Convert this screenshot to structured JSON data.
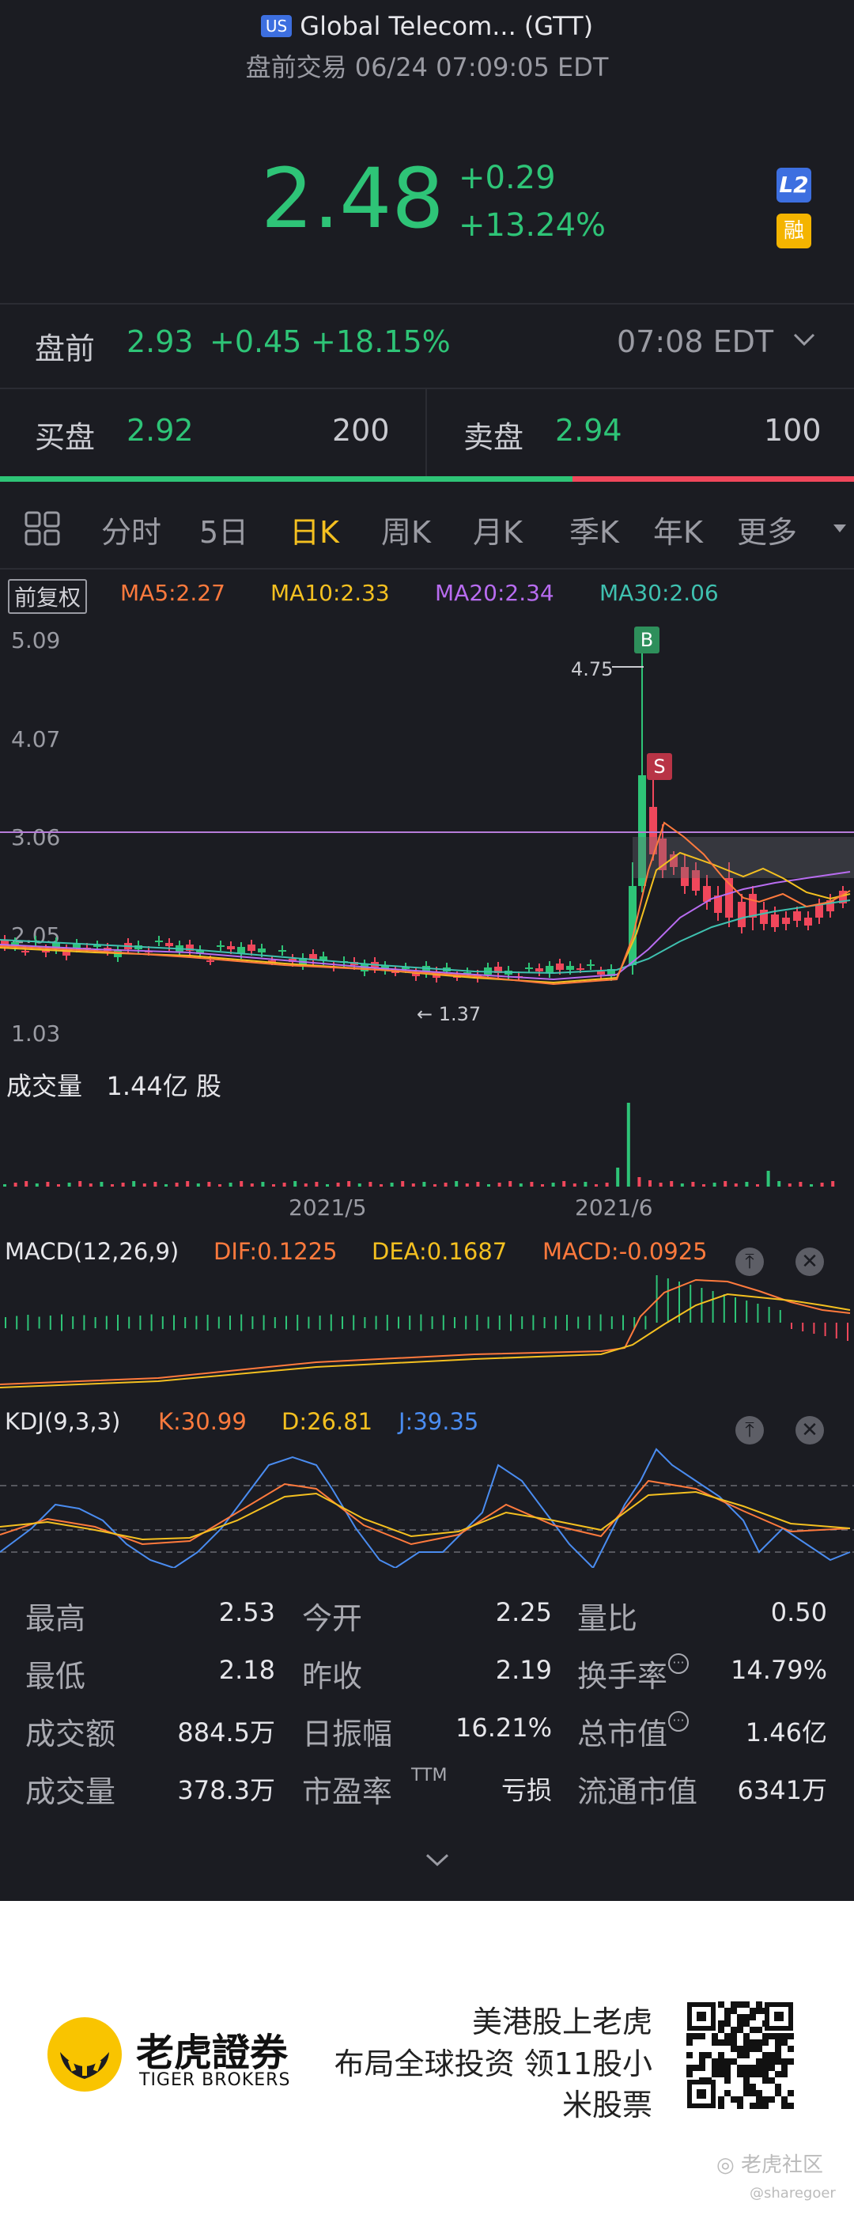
{
  "header": {
    "market_badge": "US",
    "title": "Global Telecom... (GTT)",
    "subtitle": "盘前交易 06/24 07:09:05 EDT"
  },
  "quote": {
    "price": "2.48",
    "change": "+0.29",
    "change_pct": "+13.24%",
    "badge_l2": "L2",
    "badge_rong": "融"
  },
  "premarket": {
    "label": "盘前",
    "price": "2.93",
    "change": "+0.45",
    "change_pct": "+18.15%",
    "time": "07:08 EDT"
  },
  "order_book": {
    "bid_label": "买盘",
    "bid_price": "2.92",
    "bid_size": "200",
    "ask_label": "卖盘",
    "ask_price": "2.94",
    "ask_size": "100",
    "bid_ratio": 0.67
  },
  "tabs": [
    {
      "label": "分时"
    },
    {
      "label": "5日"
    },
    {
      "label": "日K"
    },
    {
      "label": "周K"
    },
    {
      "label": "月K"
    },
    {
      "label": "季K"
    },
    {
      "label": "年K"
    },
    {
      "label": "更多"
    }
  ],
  "active_tab": "日K",
  "ma_legend": {
    "adjust": "前复权",
    "ma5": "MA5:2.27",
    "ma10": "MA10:2.33",
    "ma20": "MA20:2.34",
    "ma30": "MA30:2.06"
  },
  "price_chart": {
    "y_ticks": [
      "5.09",
      "4.07",
      "3.06",
      "2.05",
      "1.03"
    ],
    "high_label": "4.75",
    "low_label": "1.37",
    "buy_marker": "B",
    "sell_marker": "S",
    "x_ticks": [
      "2021/5",
      "2021/6"
    ]
  },
  "volume": {
    "label": "成交量",
    "value": "1.44亿 股"
  },
  "macd": {
    "label": "MACD(12,26,9)",
    "dif": "DIF:0.1225",
    "dea": "DEA:0.1687",
    "macd": "MACD:-0.0925"
  },
  "kdj": {
    "label": "KDJ(9,3,3)",
    "k": "K:30.99",
    "d": "D:26.81",
    "j": "J:39.35"
  },
  "stats": [
    [
      {
        "label": "最高",
        "value": "2.53"
      },
      {
        "label": "今开",
        "value": "2.25"
      },
      {
        "label": "量比",
        "value": "0.50"
      }
    ],
    [
      {
        "label": "最低",
        "value": "2.18"
      },
      {
        "label": "昨收",
        "value": "2.19"
      },
      {
        "label": "换手率",
        "value": "14.79%"
      }
    ],
    [
      {
        "label": "成交额",
        "value": "884.5万"
      },
      {
        "label": "日振幅",
        "value": "16.21%"
      },
      {
        "label": "总市值",
        "value": "1.46亿"
      }
    ],
    [
      {
        "label": "成交量",
        "value": "378.3万"
      },
      {
        "label": "市盈率",
        "value": "亏损"
      },
      {
        "label": "流通市值",
        "value": "6341万"
      }
    ]
  ],
  "pe_suffix": "TTM",
  "footer": {
    "brand_cn": "老虎證券",
    "brand_en": "TIGER BROKERS",
    "slogan_1": "美港股上老虎",
    "slogan_2": "布局全球投资 领11股小",
    "slogan_3": "米股票",
    "community": "老虎社区",
    "handle": "@sharegoer"
  },
  "colors": {
    "up": "#2ec477",
    "down": "#f0475b",
    "active_tab": "#f4c020",
    "ma5": "#ff7a3d",
    "ma10": "#f4c020",
    "ma20": "#b86cf0",
    "ma30": "#3fc1b0"
  }
}
